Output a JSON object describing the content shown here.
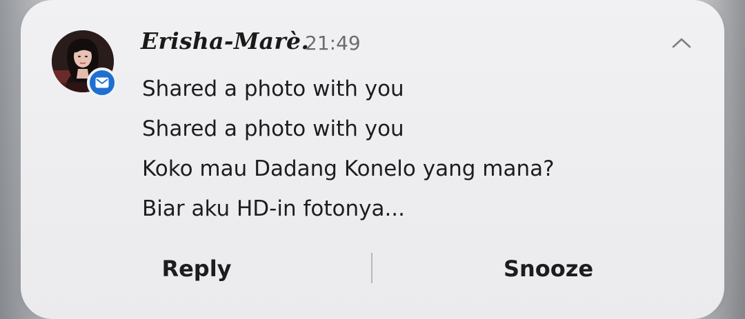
{
  "notification": {
    "sender": "Erisha-Marè.",
    "time": "21:49",
    "app_icon": "mail-icon",
    "collapse_icon": "chevron-up-icon",
    "messages": [
      "Shared a photo with you",
      "Shared a photo with you",
      "Koko mau Dadang Konelo yang mana?",
      "Biar aku HD-in fotonya..."
    ],
    "actions": {
      "reply_label": "Reply",
      "snooze_label": "Snooze"
    },
    "colors": {
      "card_background": "#f1f1f3",
      "badge": "#1e6fd1",
      "text": "#1d1d1f",
      "time_text": "#6b6b70"
    }
  }
}
